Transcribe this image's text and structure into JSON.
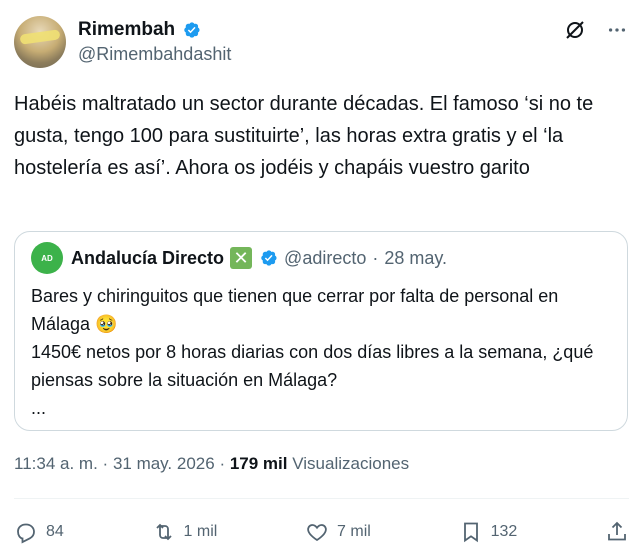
{
  "author": {
    "display_name": "Rimembah",
    "handle": "@Rimembahdashit"
  },
  "tweet": {
    "text": "Habéis maltratado un sector durante décadas. El famoso ‘si no te gusta, tengo 100 para sustituirte’, las horas extra gratis y el ‘la hostelería es así’. Ahora os jodéis y chapáis vuestro garito"
  },
  "quoted": {
    "avatar_text": "AD",
    "display_name": "Andalucía Directo",
    "x_emoji": "✕",
    "handle": "@adirecto",
    "separator": "·",
    "date": "28 may.",
    "text": "Bares y chiringuitos que tienen que cerrar por falta de personal en Málaga 🥹\n1450€ netos por 8 horas diarias con dos días libres a la semana, ¿qué piensas sobre la situación en Málaga?\n..."
  },
  "meta": {
    "time": "11:34 a. m.",
    "separator": "·",
    "date": "31 may. 2026",
    "separator2": "·",
    "views_count": "179 mil",
    "views_label": "Visualizaciones"
  },
  "actions": {
    "replies": "84",
    "reposts": "1 mil",
    "likes": "7 mil",
    "bookmarks": "132"
  },
  "colors": {
    "verified": "#1d9bf0",
    "secondary_text": "#536471",
    "border": "#cfd9de"
  },
  "icons": {
    "verified": "verified-badge-icon",
    "grok": "grok-icon",
    "more": "more-icon",
    "reply": "reply-icon",
    "repost": "repost-icon",
    "like": "like-icon",
    "bookmark": "bookmark-icon",
    "share": "share-icon"
  }
}
